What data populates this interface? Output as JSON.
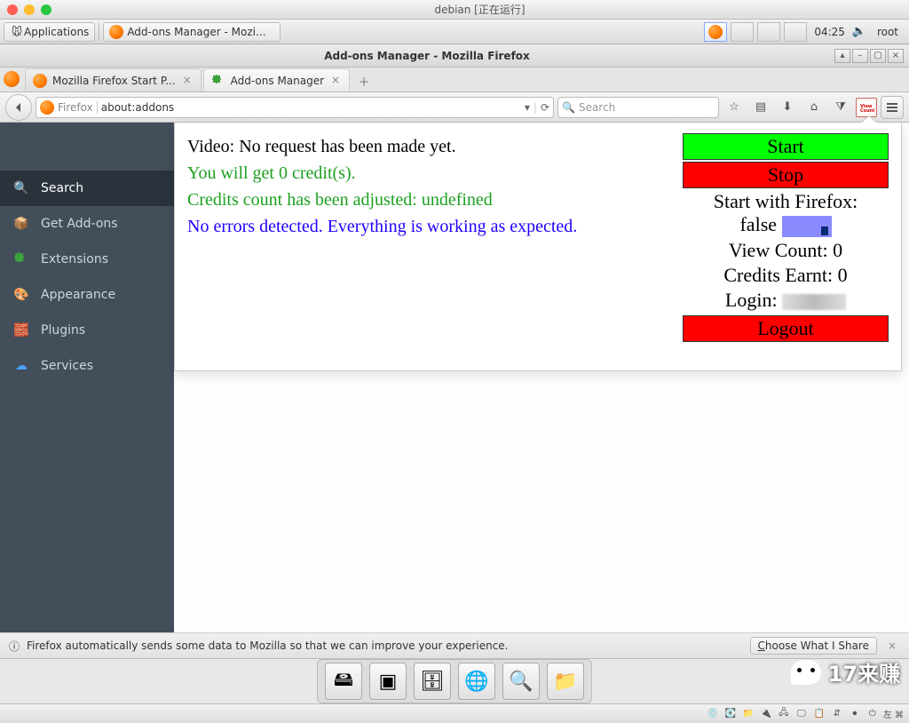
{
  "mac": {
    "title": "debian [正在运行]"
  },
  "panel": {
    "applications_label": "Applications",
    "taskbar_app": "Add-ons Manager - Mozi...",
    "clock": "04:25",
    "user": "root"
  },
  "fx_header": {
    "title": "Add-ons Manager - Mozilla Firefox"
  },
  "tabs": {
    "tab1": "Mozilla Firefox Start P...",
    "tab2": "Add-ons Manager"
  },
  "navbar": {
    "identity": "Firefox",
    "url": "about:addons",
    "search_placeholder": "Search"
  },
  "sidebar": {
    "items": [
      "Search",
      "Get Add-ons",
      "Extensions",
      "Appearance",
      "Plugins",
      "Services"
    ]
  },
  "popout": {
    "msg1": "Video: No request has been made yet.",
    "msg2": "You will get 0 credit(s).",
    "msg3": "Credits count has been adjusted: undefined",
    "msg4": "No errors detected. Everything is working as expected.",
    "start": "Start",
    "stop": "Stop",
    "start_with_firefox_label": "Start with Firefox:",
    "start_with_firefox_value": "false",
    "view_count_label": "View Count:",
    "view_count_value": "0",
    "credits_label": "Credits Earnt:",
    "credits_value": "0",
    "login_label": "Login:",
    "logout": "Logout"
  },
  "infobar": {
    "text": "Firefox automatically sends some data to Mozilla so that we can improve your experience.",
    "choose": "Choose What I Share"
  },
  "watermark": "17来赚",
  "systray_tail": "左 ⌘"
}
